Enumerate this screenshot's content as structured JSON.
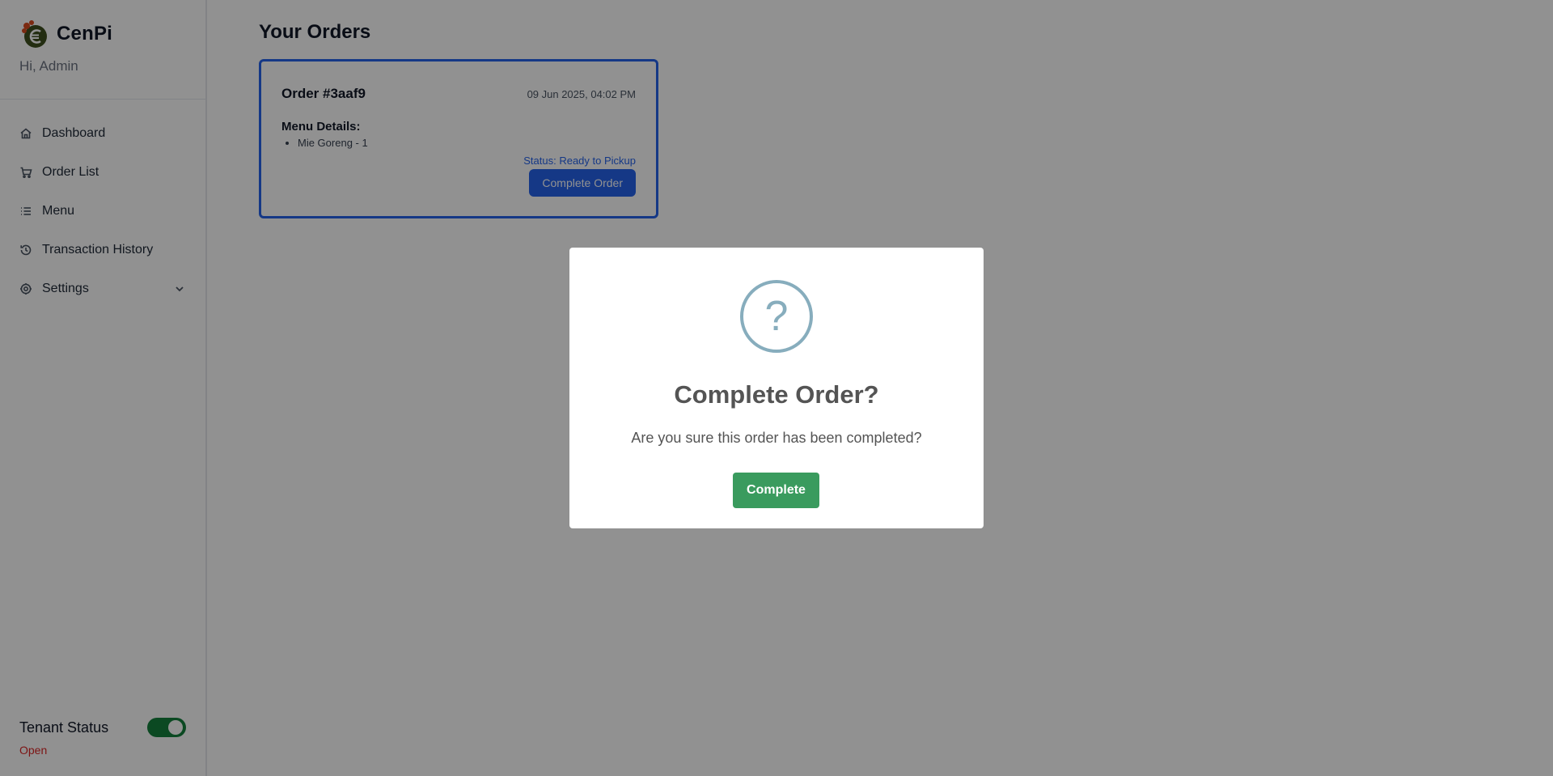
{
  "brand": {
    "name": "CenPi",
    "greeting": "Hi, Admin"
  },
  "sidebar": {
    "items": [
      {
        "label": "Dashboard",
        "icon": "home-icon"
      },
      {
        "label": "Order List",
        "icon": "cart-icon"
      },
      {
        "label": "Menu",
        "icon": "list-icon"
      },
      {
        "label": "Transaction History",
        "icon": "history-icon"
      },
      {
        "label": "Settings",
        "icon": "gear-icon"
      }
    ],
    "tenant": {
      "label": "Tenant Status",
      "status": "Open",
      "toggle_on": true
    }
  },
  "main": {
    "title": "Your Orders",
    "order": {
      "id": "Order #3aaf9",
      "date": "09 Jun 2025, 04:02 PM",
      "menu_title": "Menu Details:",
      "items": [
        "Mie Goreng - 1"
      ],
      "status": "Status: Ready to Pickup",
      "button_label": "Complete Order"
    }
  },
  "modal": {
    "icon": "?",
    "title": "Complete Order?",
    "text": "Are you sure this order has been completed?",
    "confirm_label": "Complete"
  },
  "colors": {
    "accent": "#2563eb",
    "confirm": "#3a9b5e",
    "toggle": "#15803d",
    "open_status": "#dc2626",
    "question_icon": "#87adbd"
  }
}
